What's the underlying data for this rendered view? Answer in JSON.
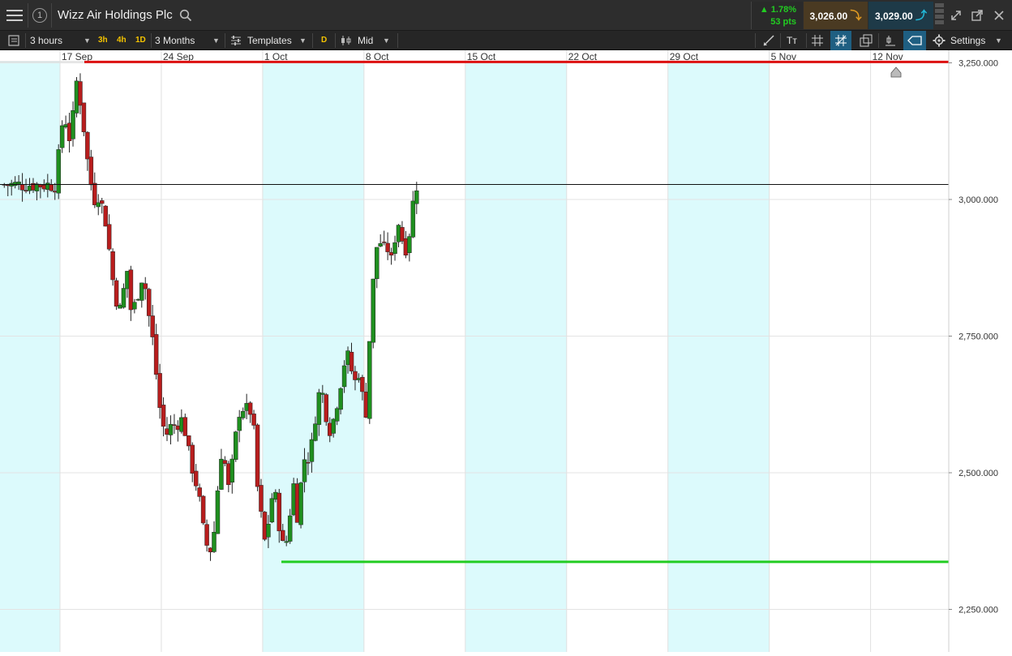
{
  "header": {
    "menu_icon": "hamburger-menu-icon",
    "slot_number": "1",
    "instrument_title": "Wizz Air Holdings Plc",
    "search_icon": "search-icon",
    "change_percent": "1.78%",
    "change_points": "53 pts",
    "sell_price": "3,026.00",
    "buy_price": "3,029.00",
    "up_color": "#22cc22",
    "sell_color": "#4a3a22",
    "buy_color": "#1e3a48"
  },
  "toolbar": {
    "interval": "3 hours",
    "quick_intervals": [
      "3h",
      "4h",
      "1D"
    ],
    "range": "3 Months",
    "templates": "Templates",
    "d_button": "D",
    "price_type": "Mid",
    "text_tool": "Tт",
    "settings": "Settings"
  },
  "chart_data": {
    "type": "candlestick",
    "instrument": "Wizz Air Holdings Plc",
    "x_axis_labels": [
      "17 Sep",
      "24 Sep",
      "1 Oct",
      "8 Oct",
      "15 Oct",
      "22 Oct",
      "29 Oct",
      "5 Nov",
      "12 Nov"
    ],
    "y_axis_labels": [
      "3,250.000",
      "3,000.000",
      "2,750.000",
      "2,500.000",
      "2,250.000"
    ],
    "ylim": [
      2230,
      3260
    ],
    "current_price_label": "3,027.500",
    "current_price": 3027.5,
    "resistance_label": "3,251.648",
    "resistance": 3251.648,
    "support_label": "2,337.000",
    "support": 2337.0,
    "colors": {
      "up": "#1f8f1f",
      "down": "#b81d1d",
      "resistance_line": "#dd1111",
      "support_line": "#22cc22",
      "shade": "#dcfafc"
    },
    "close_path": [
      [
        0,
        3030
      ],
      [
        0.04,
        3120
      ],
      [
        0.08,
        3160
      ],
      [
        0.12,
        3110
      ],
      [
        0.16,
        3130
      ],
      [
        0.18,
        3230
      ],
      [
        0.22,
        3200
      ],
      [
        0.26,
        3150
      ],
      [
        0.3,
        3080
      ],
      [
        0.34,
        3030
      ],
      [
        0.38,
        3000
      ],
      [
        0.42,
        3010
      ],
      [
        0.46,
        2980
      ],
      [
        0.5,
        2950
      ],
      [
        0.54,
        2870
      ],
      [
        0.58,
        2830
      ],
      [
        0.62,
        2790
      ],
      [
        0.66,
        2830
      ],
      [
        0.7,
        2870
      ],
      [
        0.74,
        2790
      ],
      [
        0.78,
        2810
      ],
      [
        0.82,
        2840
      ],
      [
        0.86,
        2870
      ],
      [
        0.9,
        2800
      ],
      [
        0.94,
        2760
      ],
      [
        0.98,
        2690
      ],
      [
        1.02,
        2620
      ],
      [
        1.06,
        2580
      ],
      [
        1.1,
        2570
      ],
      [
        1.14,
        2590
      ],
      [
        1.18,
        2585
      ],
      [
        1.22,
        2600
      ],
      [
        1.26,
        2590
      ],
      [
        1.3,
        2540
      ],
      [
        1.34,
        2510
      ],
      [
        1.38,
        2480
      ],
      [
        1.42,
        2440
      ],
      [
        1.46,
        2380
      ],
      [
        1.5,
        2360
      ],
      [
        1.54,
        2360
      ],
      [
        1.58,
        2440
      ],
      [
        1.62,
        2540
      ],
      [
        1.66,
        2520
      ],
      [
        1.7,
        2470
      ],
      [
        1.74,
        2520
      ],
      [
        1.78,
        2580
      ],
      [
        1.82,
        2630
      ],
      [
        1.86,
        2610
      ],
      [
        1.9,
        2620
      ],
      [
        1.94,
        2600
      ],
      [
        1.98,
        2480
      ],
      [
        2.02,
        2420
      ],
      [
        2.06,
        2370
      ],
      [
        2.1,
        2420
      ],
      [
        2.14,
        2470
      ],
      [
        2.18,
        2440
      ],
      [
        2.22,
        2370
      ],
      [
        2.26,
        2360
      ],
      [
        2.3,
        2420
      ],
      [
        2.34,
        2480
      ],
      [
        2.38,
        2420
      ],
      [
        2.42,
        2490
      ],
      [
        2.46,
        2540
      ],
      [
        2.5,
        2520
      ],
      [
        2.54,
        2580
      ],
      [
        2.58,
        2640
      ],
      [
        2.62,
        2650
      ],
      [
        2.66,
        2610
      ],
      [
        2.7,
        2580
      ],
      [
        2.74,
        2600
      ],
      [
        2.78,
        2640
      ],
      [
        2.82,
        2680
      ],
      [
        2.86,
        2720
      ],
      [
        2.9,
        2700
      ],
      [
        2.94,
        2660
      ],
      [
        2.98,
        2690
      ],
      [
        3.02,
        2640
      ],
      [
        3.06,
        2610
      ],
      [
        3.1,
        2780
      ],
      [
        3.14,
        2880
      ],
      [
        3.18,
        2940
      ],
      [
        3.22,
        2900
      ],
      [
        3.26,
        2920
      ],
      [
        3.3,
        2880
      ],
      [
        3.34,
        2930
      ],
      [
        3.38,
        2960
      ],
      [
        3.42,
        2920
      ],
      [
        3.46,
        2910
      ],
      [
        3.5,
        2960
      ],
      [
        3.54,
        3027
      ]
    ]
  }
}
